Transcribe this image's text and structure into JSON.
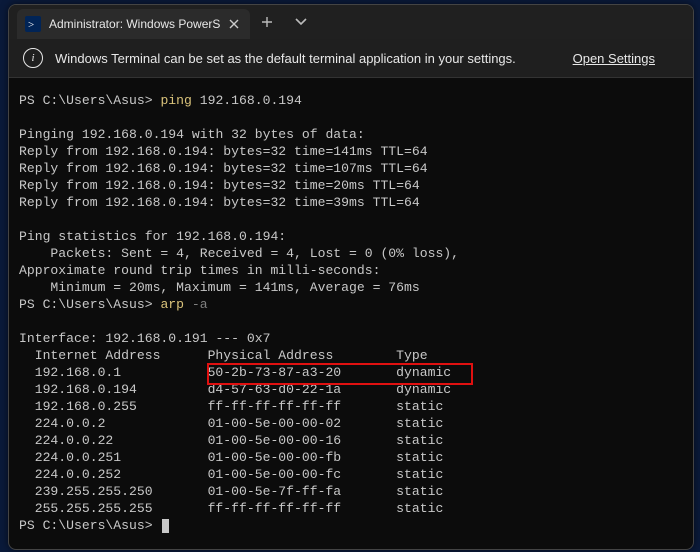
{
  "tab": {
    "title": "Administrator: Windows PowerS"
  },
  "infobar": {
    "message": "Windows Terminal can be set as the default terminal application in your settings.",
    "link": "Open Settings"
  },
  "prompt": "PS C:\\Users\\Asus>",
  "cmd1_a": "ping",
  "cmd1_b": " 192.168.0.194",
  "ping": {
    "header": "Pinging 192.168.0.194 with 32 bytes of data:",
    "r1": "Reply from 192.168.0.194: bytes=32 time=141ms TTL=64",
    "r2": "Reply from 192.168.0.194: bytes=32 time=107ms TTL=64",
    "r3": "Reply from 192.168.0.194: bytes=32 time=20ms TTL=64",
    "r4": "Reply from 192.168.0.194: bytes=32 time=39ms TTL=64",
    "stats_h": "Ping statistics for 192.168.0.194:",
    "stats_p": "    Packets: Sent = 4, Received = 4, Lost = 0 (0% loss),",
    "rtt_h": "Approximate round trip times in milli-seconds:",
    "rtt_v": "    Minimum = 20ms, Maximum = 141ms, Average = 76ms"
  },
  "cmd2_a": "arp",
  "cmd2_b": " -a",
  "arp": {
    "iface": "Interface: 192.168.0.191 --- 0x7",
    "h_ip": "  Internet Address",
    "h_mac": "Physical Address",
    "h_typ": "Type",
    "rows": [
      {
        "ip": "  192.168.0.1",
        "mac": "50-2b-73-87-a3-20",
        "typ": "dynamic"
      },
      {
        "ip": "  192.168.0.194",
        "mac": "d4-57-63-d0-22-1a",
        "typ": "dynamic"
      },
      {
        "ip": "  192.168.0.255",
        "mac": "ff-ff-ff-ff-ff-ff",
        "typ": "static"
      },
      {
        "ip": "  224.0.0.2",
        "mac": "01-00-5e-00-00-02",
        "typ": "static"
      },
      {
        "ip": "  224.0.0.22",
        "mac": "01-00-5e-00-00-16",
        "typ": "static"
      },
      {
        "ip": "  224.0.0.251",
        "mac": "01-00-5e-00-00-fb",
        "typ": "static"
      },
      {
        "ip": "  224.0.0.252",
        "mac": "01-00-5e-00-00-fc",
        "typ": "static"
      },
      {
        "ip": "  239.255.255.250",
        "mac": "01-00-5e-7f-ff-fa",
        "typ": "static"
      },
      {
        "ip": "  255.255.255.255",
        "mac": "ff-ff-ff-ff-ff-ff",
        "typ": "static"
      }
    ]
  }
}
